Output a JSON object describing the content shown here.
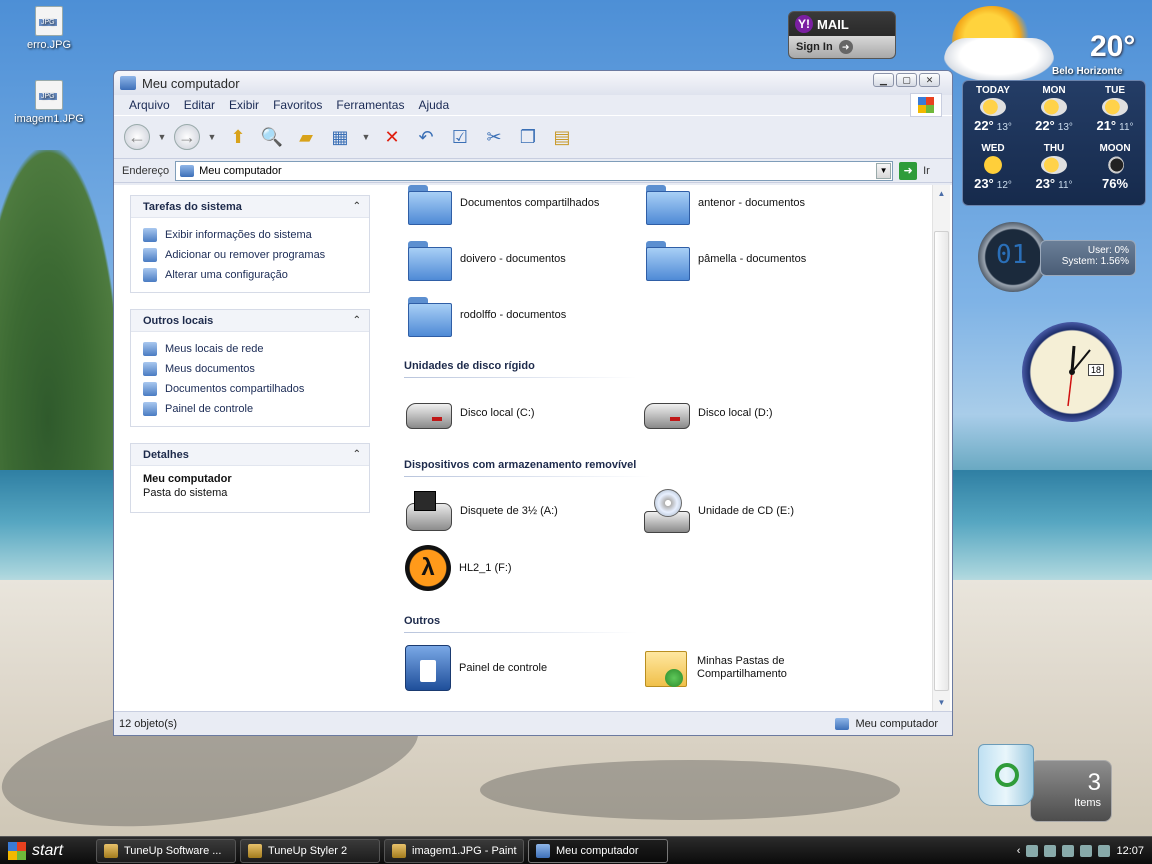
{
  "desktop": {
    "icons": [
      {
        "label": "erro.JPG"
      },
      {
        "label": "imagem1.JPG"
      }
    ]
  },
  "yahoo_mail": {
    "brand": "MAIL",
    "logo": "Y!",
    "signin": "Sign In"
  },
  "weather": {
    "temp": "20°",
    "city": "Belo Horizonte",
    "days": [
      {
        "day": "TODAY",
        "hi": "22°",
        "lo": "13°",
        "icon": "partly-cloudy-icon"
      },
      {
        "day": "MON",
        "hi": "22°",
        "lo": "13°",
        "icon": "partly-cloudy-icon"
      },
      {
        "day": "TUE",
        "hi": "21°",
        "lo": "11°",
        "icon": "partly-cloudy-icon"
      },
      {
        "day": "WED",
        "hi": "23°",
        "lo": "12°",
        "icon": "sun-icon"
      },
      {
        "day": "THU",
        "hi": "23°",
        "lo": "11°",
        "icon": "partly-cloudy-icon"
      },
      {
        "day": "MOON",
        "hi": "76%",
        "lo": "",
        "icon": "moon-icon"
      }
    ]
  },
  "cpu_meter": {
    "digits": "01",
    "user": "User: 0%",
    "system": "System: 1.56%"
  },
  "clock": {
    "date": "18"
  },
  "recycle_bin": {
    "count": "3",
    "label": "Items"
  },
  "window": {
    "title": "Meu computador",
    "menu": [
      "Arquivo",
      "Editar",
      "Exibir",
      "Favoritos",
      "Ferramentas",
      "Ajuda"
    ],
    "address": {
      "label": "Endereço",
      "value": "Meu computador",
      "go": "Ir"
    },
    "tasks_panel": {
      "title": "Tarefas do sistema",
      "items": [
        "Exibir informações do sistema",
        "Adicionar ou remover programas",
        "Alterar uma configuração"
      ]
    },
    "places_panel": {
      "title": "Outros locais",
      "items": [
        "Meus locais de rede",
        "Meus documentos",
        "Documentos compartilhados",
        "Painel de controle"
      ]
    },
    "details_panel": {
      "title": "Detalhes",
      "name": "Meu computador",
      "desc": "Pasta do sistema"
    },
    "folders": [
      "Documentos compartilhados",
      "antenor - documentos",
      "doivero - documentos",
      "pâmella - documentos",
      "rodolffo - documentos"
    ],
    "sections": {
      "hard_disks": "Unidades de disco rígido",
      "removable": "Dispositivos com armazenamento removível",
      "others": "Outros"
    },
    "drives": [
      "Disco local (C:)",
      "Disco local (D:)"
    ],
    "removable_items": [
      "Disquete de 3½ (A:)",
      "Unidade de CD (E:)",
      "HL2_1 (F:)"
    ],
    "other_items": {
      "cpanel": "Painel de controle",
      "share_line1": "Minhas Pastas de",
      "share_line2": "Compartilhamento"
    },
    "status": {
      "count": "12 objeto(s)",
      "location": "Meu computador"
    }
  },
  "taskbar": {
    "start": "start",
    "tasks": [
      "TuneUp Software ...",
      "TuneUp Styler 2",
      "imagem1.JPG - Paint",
      "Meu computador"
    ],
    "time": "12:07"
  }
}
